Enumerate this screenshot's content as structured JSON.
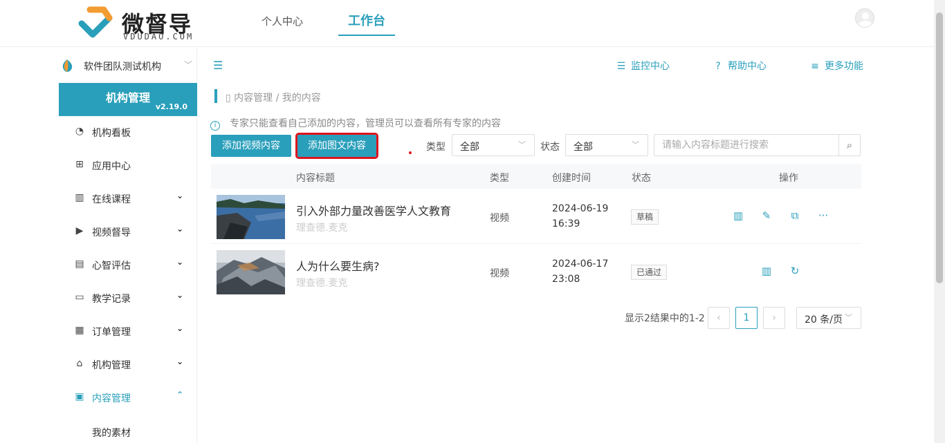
{
  "brand": {
    "name_cn": "微督导",
    "name_en": "VDUDAO.COM"
  },
  "topnav": {
    "personal": "个人中心",
    "workbench": "工作台"
  },
  "header_links": {
    "monitor": "监控中心",
    "help": "帮助中心",
    "more": "更多功能"
  },
  "sidebar": {
    "org_name": "软件团队测试机构",
    "header_title": "机构管理",
    "version": "v2.19.0",
    "items": [
      {
        "label": "机构看板",
        "icon": "pie-chart-icon",
        "has_children": false
      },
      {
        "label": "应用中心",
        "icon": "grid-icon",
        "has_children": false
      },
      {
        "label": "在线课程",
        "icon": "book-icon",
        "has_children": true
      },
      {
        "label": "视频督导",
        "icon": "play-icon",
        "has_children": true
      },
      {
        "label": "心智评估",
        "icon": "report-icon",
        "has_children": true
      },
      {
        "label": "教学记录",
        "icon": "camera-icon",
        "has_children": true
      },
      {
        "label": "订单管理",
        "icon": "order-icon",
        "has_children": true
      },
      {
        "label": "机构管理",
        "icon": "bank-icon",
        "has_children": true
      },
      {
        "label": "内容管理",
        "icon": "document-icon",
        "has_children": true,
        "expanded": true
      }
    ],
    "sub_items": [
      "我的素材"
    ]
  },
  "breadcrumb": "内容管理 / 我的内容",
  "notice": "专家只能查看自己添加的内容，管理员可以查看所有专家的内容",
  "buttons": {
    "add_video": "添加视频内容",
    "add_article": "添加图文内容"
  },
  "filters": {
    "type_label": "类型",
    "type_value": "全部",
    "status_label": "状态",
    "status_value": "全部",
    "search_placeholder": "请输入内容标题进行搜索"
  },
  "table": {
    "headers": {
      "title": "内容标题",
      "type": "类型",
      "created": "创建时间",
      "status": "状态",
      "actions": "操作"
    },
    "rows": [
      {
        "title": "引入外部力量改善医学人文教育",
        "author": "理查德.麦克",
        "type": "视频",
        "date": "2024-06-19",
        "time": "16:39",
        "status": "草稿",
        "actions": [
          "preview-icon",
          "edit-icon",
          "copy-icon",
          "more-icon"
        ]
      },
      {
        "title": "人为什么要生病?",
        "author": "理查德.麦克",
        "type": "视频",
        "date": "2024-06-17",
        "time": "23:08",
        "status": "已通过",
        "actions": [
          "preview-icon",
          "refresh-icon"
        ]
      }
    ]
  },
  "pagination": {
    "summary": "显示2结果中的1-2",
    "current": "1",
    "prev": "‹",
    "next": "›",
    "page_size": "20 条/页"
  },
  "colors": {
    "accent": "#2a9fbb",
    "highlight": "#e0141e"
  }
}
